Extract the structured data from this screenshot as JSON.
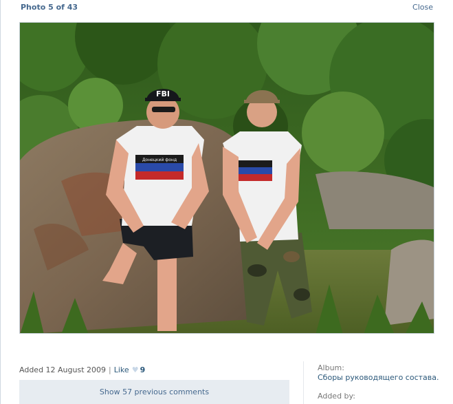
{
  "header": {
    "counter": "Photo 5 of 43",
    "close_label": "Close"
  },
  "photo": {
    "description": "Two men in white t-shirts standing in front of a large boulder with trees behind them",
    "left_cap_text": "FBI",
    "shirt_text": "Донецкий фонд"
  },
  "meta": {
    "added": "Added 12 August 2009",
    "separator": "|",
    "like_label": "Like",
    "like_count": "9",
    "show_comments": "Show 57 previous comments"
  },
  "sidebar": {
    "album_label": "Album:",
    "album_name": "Сборы руководящего состава.",
    "added_by_label": "Added by:"
  },
  "colors": {
    "link": "#2b587a",
    "header_link": "#45688e",
    "comments_bg": "#e7ecf1"
  }
}
